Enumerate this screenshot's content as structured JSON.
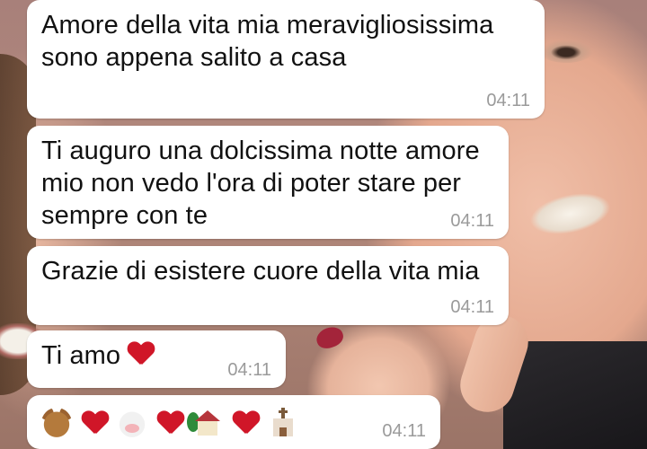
{
  "messages": [
    {
      "text": "Amore della vita mia meravigliosissima sono appena salito a casa",
      "time": "04:11"
    },
    {
      "text": "Ti auguro una dolcissima notte amore mio non vedo l'ora di poter stare per sempre con te",
      "time": "04:11"
    },
    {
      "text": "Grazie di esistere cuore della vita mia",
      "time": "04:11"
    },
    {
      "text": "Ti amo",
      "time": "04:11",
      "emoji": "red-heart"
    },
    {
      "text": "",
      "time": "04:11",
      "emojis": [
        "bear-face",
        "red-heart",
        "cow-face",
        "red-heart",
        "house-with-garden",
        "red-heart",
        "church"
      ]
    }
  ],
  "colors": {
    "bubble": "#ffffff",
    "timestamp": "#9a9a9a",
    "heart": "#d01628"
  }
}
